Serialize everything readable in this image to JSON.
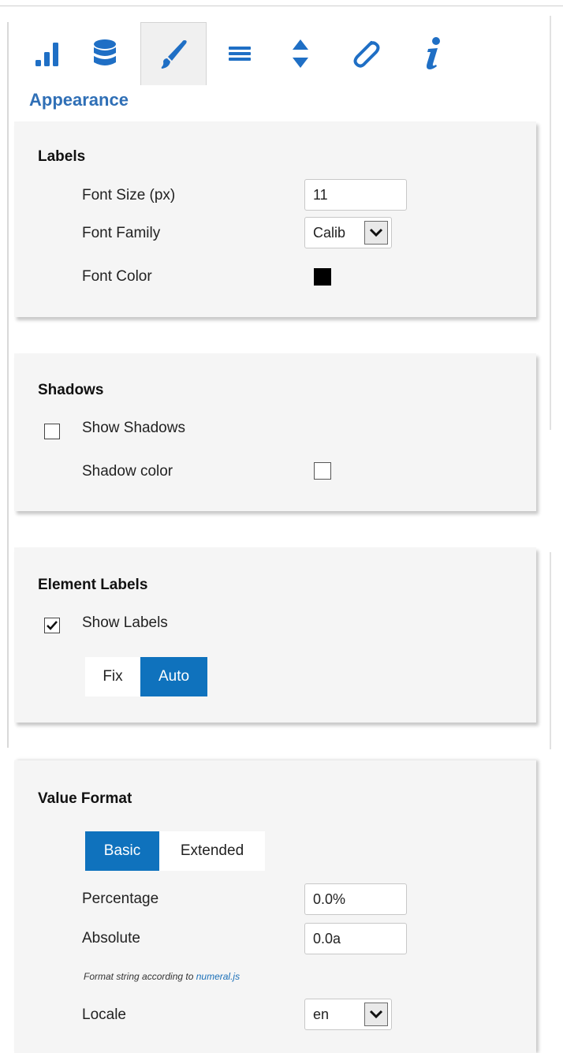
{
  "toolbar": {
    "tabs": [
      {
        "name": "chart-icon"
      },
      {
        "name": "database-icon"
      },
      {
        "name": "brush-icon",
        "active": true
      },
      {
        "name": "list-icon"
      },
      {
        "name": "sort-arrows-icon"
      },
      {
        "name": "paperclip-icon"
      },
      {
        "name": "info-icon"
      }
    ],
    "accent": "#1f6fc5"
  },
  "section_title": "Appearance",
  "labels_panel": {
    "title": "Labels",
    "font_size_label": "Font Size (px)",
    "font_size_value": "11",
    "font_family_label": "Font Family",
    "font_family_value": "Calib",
    "font_color_label": "Font Color",
    "font_color": "#000000"
  },
  "shadows_panel": {
    "title": "Shadows",
    "show_shadows_label": "Show Shadows",
    "show_shadows_checked": false,
    "shadow_color_label": "Shadow color",
    "shadow_color": "#ffffff"
  },
  "element_labels_panel": {
    "title": "Element Labels",
    "show_labels_label": "Show Labels",
    "show_labels_checked": true,
    "mode_options": [
      "Fix",
      "Auto"
    ],
    "mode_selected": "Auto"
  },
  "value_format_panel": {
    "title": "Value Format",
    "mode_options": [
      "Basic",
      "Extended"
    ],
    "mode_selected": "Basic",
    "percentage_label": "Percentage",
    "percentage_value": "0.0%",
    "absolute_label": "Absolute",
    "absolute_value": "0.0a",
    "note_text": "Format string according to ",
    "note_link": "numeral.js",
    "locale_label": "Locale",
    "locale_value": "en"
  }
}
